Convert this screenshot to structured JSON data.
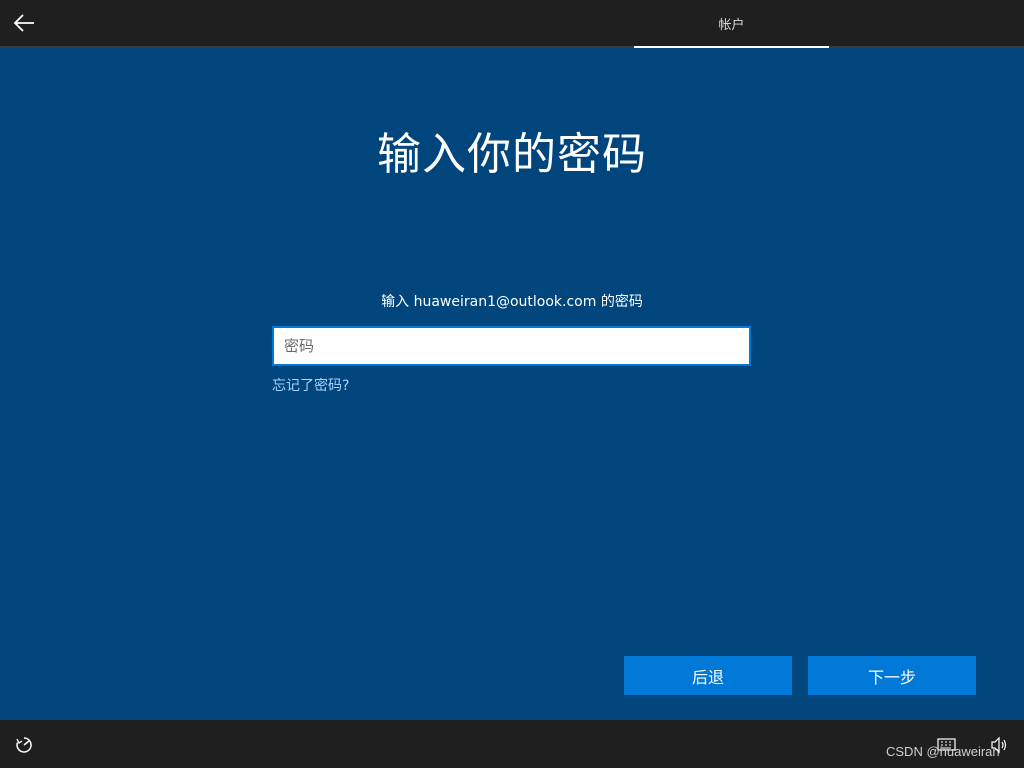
{
  "header": {
    "back_icon": "arrow-left-icon",
    "tab_label": "帐户"
  },
  "main": {
    "title": "输入你的密码",
    "prompt": "输入 huaweiran1@outlook.com 的密码",
    "password_placeholder": "密码",
    "password_value": "",
    "forgot_link": "忘记了密码?"
  },
  "buttons": {
    "back_label": "后退",
    "next_label": "下一步"
  },
  "footer": {
    "accessibility_icon": "ease-of-access-icon",
    "keyboard_icon": "keyboard-icon",
    "volume_icon": "volume-icon",
    "watermark": "CSDN @huaweiran"
  },
  "colors": {
    "background": "#00457c",
    "bar": "#1f1f1f",
    "accent": "#0078d7",
    "link": "#a8d3ff"
  }
}
